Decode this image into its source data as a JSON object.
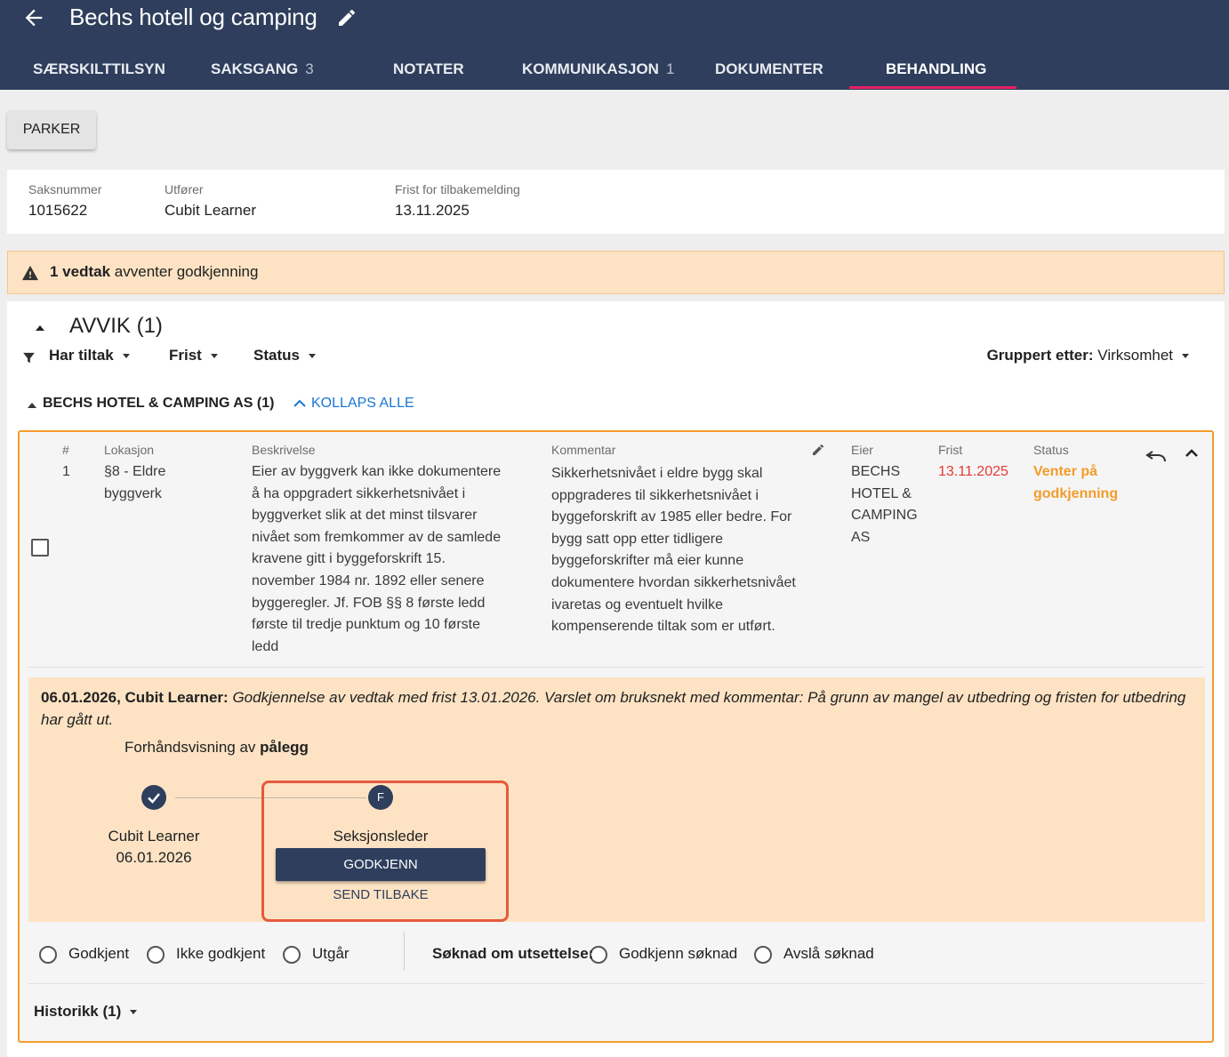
{
  "header": {
    "title": "Bechs hotell og camping",
    "tabs": [
      {
        "label": "SÆRSKILTTILSYN",
        "count": ""
      },
      {
        "label": "SAKSGANG",
        "count": "3"
      },
      {
        "label": "NOTATER",
        "count": ""
      },
      {
        "label": "KOMMUNIKASJON",
        "count": "1"
      },
      {
        "label": "DOKUMENTER",
        "count": ""
      },
      {
        "label": "BEHANDLING",
        "count": ""
      }
    ],
    "active_tab": "BEHANDLING"
  },
  "actions": {
    "parker_label": "PARKER"
  },
  "case_info": {
    "saksnummer_label": "Saksnummer",
    "saksnummer": "1015622",
    "utforer_label": "Utfører",
    "utforer": "Cubit Learner",
    "frist_label": "Frist for tilbakemelding",
    "frist": "13.11.2025"
  },
  "warning": {
    "bold": "1 vedtak",
    "text": "avventer godkjenning"
  },
  "section": {
    "title": "AVVIK (1)",
    "filters": [
      "Har tiltak",
      "Frist",
      "Status"
    ],
    "grouped_label": "Gruppert etter:",
    "grouped_value": "Virksomhet"
  },
  "group": {
    "title": "BECHS HOTEL & CAMPING AS (1)",
    "collapse_all": "KOLLAPS ALLE"
  },
  "deviation": {
    "labels": {
      "num": "#",
      "lokasjon": "Lokasjon",
      "beskrivelse": "Beskrivelse",
      "kommentar": "Kommentar",
      "eier": "Eier",
      "frist": "Frist",
      "status": "Status"
    },
    "num": "1",
    "lokasjon_lines": [
      "§8 - Eldre",
      "byggverk"
    ],
    "beskrivelse_lines": [
      "Eier av byggverk kan ikke dokumentere",
      "å ha oppgradert sikkerhetsnivået i",
      "byggverket slik at det minst tilsvarer",
      "nivået som fremkommer av de samlede",
      "kravene gitt i byggeforskrift 15.",
      "november 1984 nr. 1892 eller senere",
      "byggeregler. Jf. FOB §§ 8 første ledd",
      "første til tredje punktum og 10 første",
      "ledd"
    ],
    "kommentar_lines": [
      "Sikkerhetsnivået i eldre bygg skal",
      "oppgraderes til sikkerhetsnivået i",
      "byggeforskrift av 1985 eller bedre. For",
      "bygg satt opp etter tidligere",
      "byggeforskrifter må eier kunne",
      "dokumentere hvordan sikkerhetsnivået",
      "ivaretas og eventuelt hvilke",
      "kompenserende tiltak som er utført."
    ],
    "eier_lines": [
      "BECHS",
      "HOTEL &",
      "CAMPING",
      "AS"
    ],
    "frist": "13.11.2025",
    "frist_color": "#e53935",
    "status_lines": [
      "Venter på",
      "godkjenning"
    ],
    "status_color": "#f39c2a"
  },
  "approval": {
    "author": "06.01.2026, Cubit Learner:",
    "message": "Godkjennelse av vedtak med frist 13.01.2026. Varslet om bruksnekt med kommentar: På grunn av mangel av utbedring og fristen for utbedring har gått ut.",
    "preview_prefix": "Forhåndsvisning av",
    "preview_bold": "pålegg",
    "step1": {
      "name": "Cubit Learner",
      "date": "06.01.2026"
    },
    "step2": {
      "initial": "F",
      "name": "Seksjonsleder"
    },
    "approve_label": "GODKJENN",
    "send_back_label": "SEND TILBAKE"
  },
  "decision": {
    "options": [
      "Godkjent",
      "Ikke godkjent",
      "Utgår"
    ],
    "soknad_label": "Søknad om utsettelse:",
    "soknad_options": [
      "Godkjenn søknad",
      "Avslå søknad"
    ]
  },
  "history": {
    "label": "Historikk (1)"
  }
}
